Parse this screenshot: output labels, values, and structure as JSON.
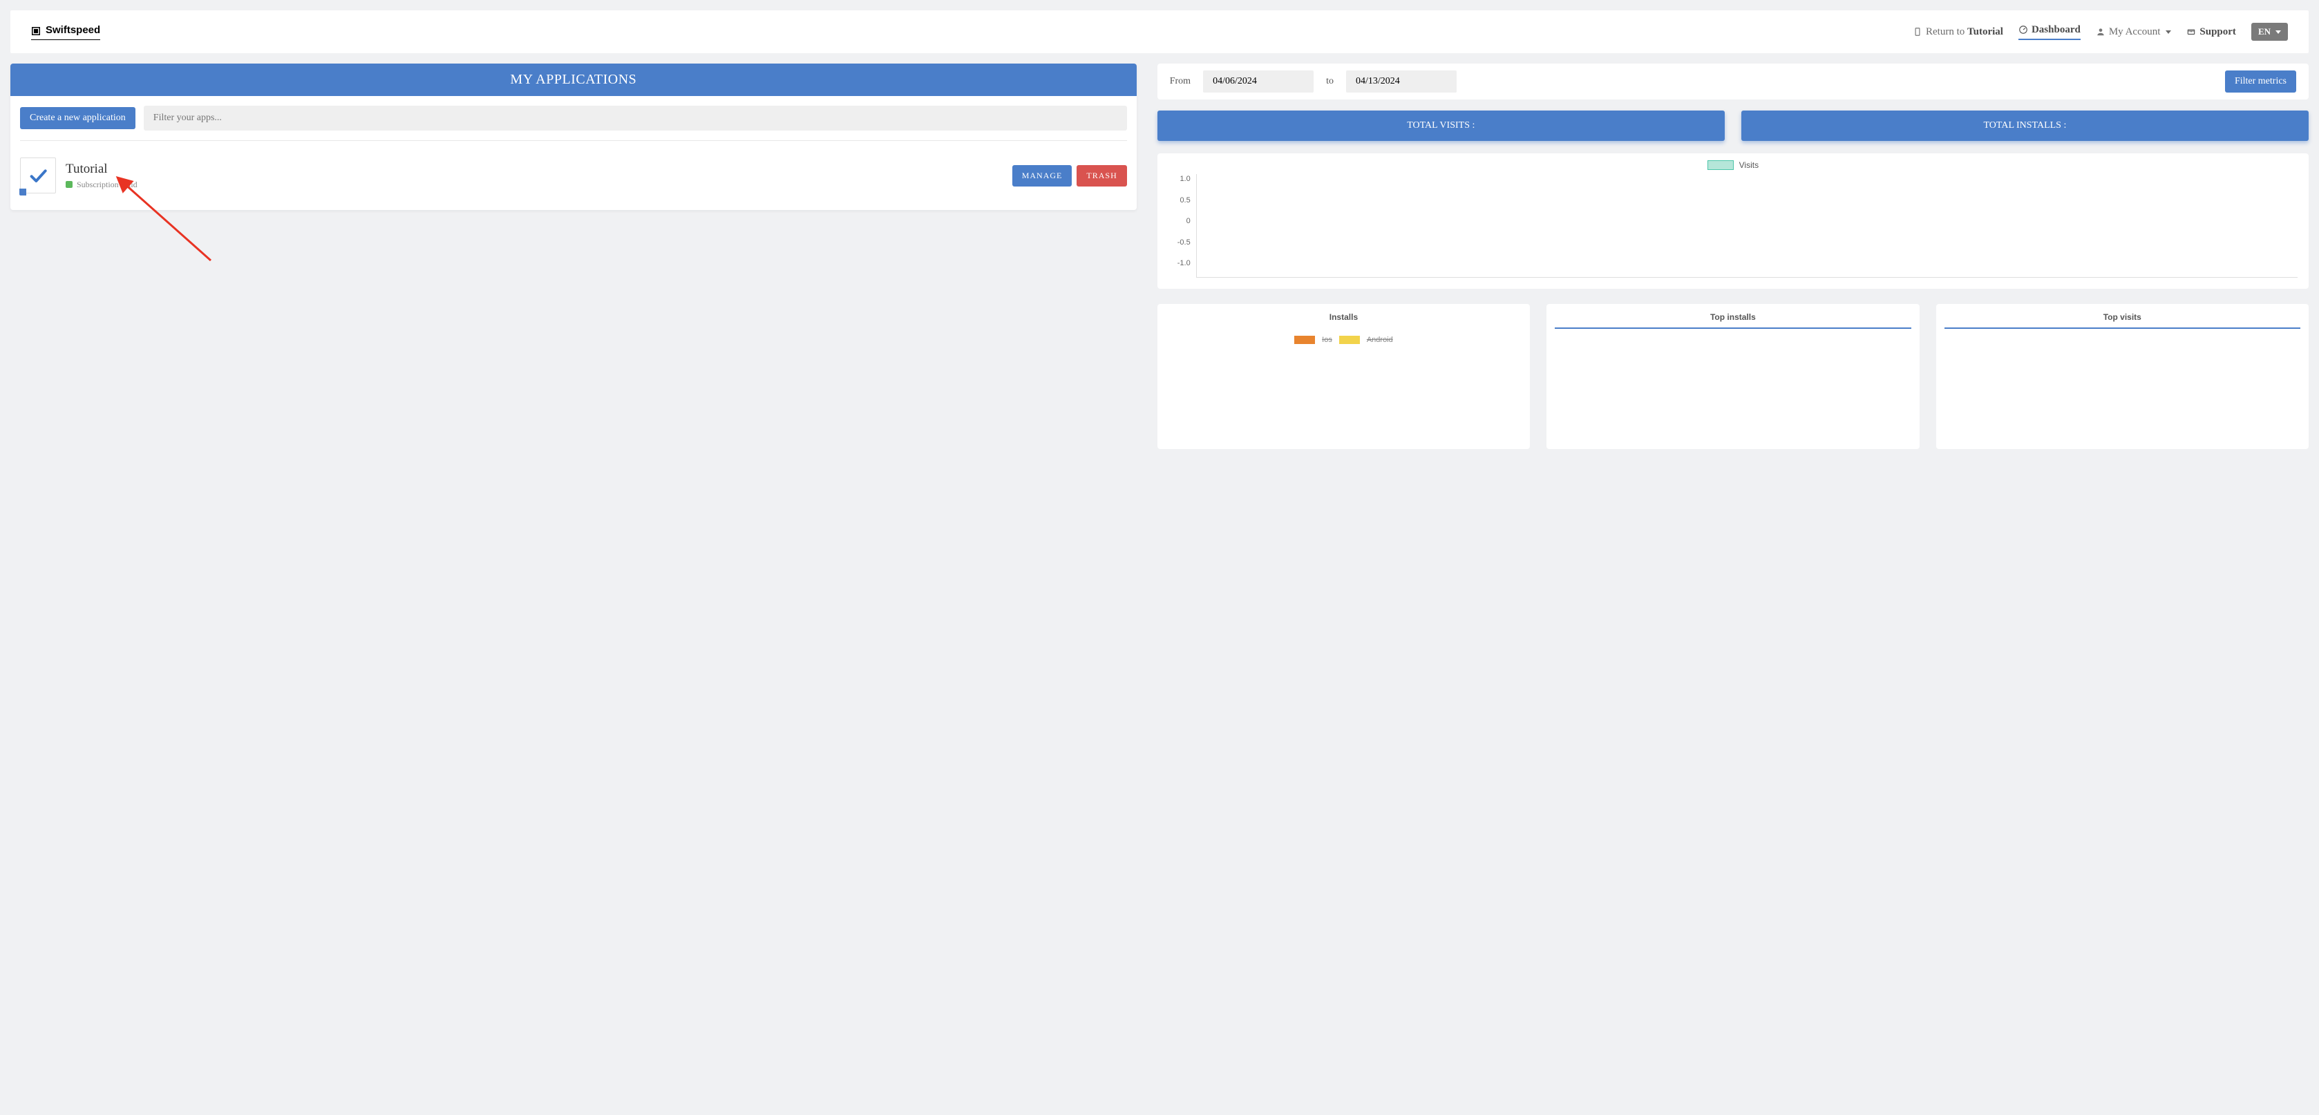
{
  "brand": "Swiftspeed",
  "nav": {
    "return_prefix": "Return to ",
    "return_target": "Tutorial",
    "dashboard": "Dashboard",
    "my_account": "My Account",
    "support": "Support",
    "lang": "EN"
  },
  "apps_panel": {
    "title": "MY APPLICATIONS",
    "create_btn": "Create a new application",
    "filter_placeholder": "Filter your apps...",
    "items": [
      {
        "name": "Tutorial",
        "status": "Subscription valid",
        "manage": "MANAGE",
        "trash": "TRASH"
      }
    ]
  },
  "date_filter": {
    "from_label": "From",
    "from_value": "04/06/2024",
    "to_label": "to",
    "to_value": "04/13/2024",
    "button": "Filter metrics"
  },
  "totals": {
    "visits": "TOTAL VISITS :",
    "installs": "TOTAL INSTALLS :"
  },
  "chart": {
    "legend": "Visits",
    "yticks": [
      "1.0",
      "0.5",
      "0",
      "-0.5",
      "-1.0"
    ]
  },
  "bottom": {
    "installs": "Installs",
    "top_installs": "Top installs",
    "top_visits": "Top visits",
    "ios": "Ios",
    "android": "Android"
  },
  "chart_data": {
    "type": "line",
    "title": "",
    "xlabel": "",
    "ylabel": "",
    "ylim": [
      -1.0,
      1.0
    ],
    "series": [
      {
        "name": "Visits",
        "values": []
      }
    ]
  }
}
